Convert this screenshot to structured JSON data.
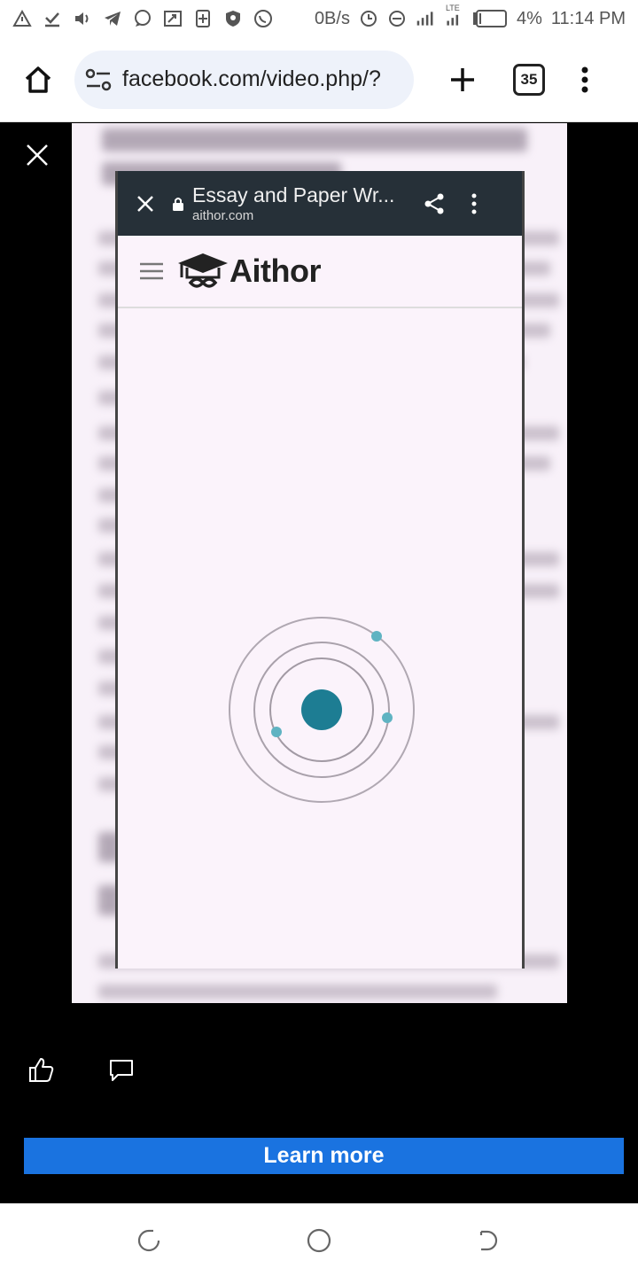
{
  "status_bar": {
    "net_speed": "0B/s",
    "network_type": "LTE",
    "battery": "4%",
    "time": "11:14 PM",
    "icons": [
      "alert-icon",
      "download-done-icon",
      "volume-icon",
      "telegram-icon",
      "chat-icon",
      "cast-icon",
      "sim-icon",
      "shield-icon",
      "whatsapp-icon",
      "data-saver-icon",
      "dnd-icon",
      "signal-icon",
      "signal-icon-2",
      "battery-icon"
    ]
  },
  "browser": {
    "url": "facebook.com/video.php/?",
    "tab_count": "35",
    "icons": {
      "home": "home-icon",
      "site_info": "tune-icon",
      "new_tab": "plus-icon",
      "menu": "more-vert-icon"
    }
  },
  "video": {
    "custom_tab": {
      "title": "Essay and Paper Wr...",
      "domain": "aithor.com"
    },
    "site": {
      "brand": "Aithor"
    },
    "colors": {
      "loader_core": "#1d7d93",
      "loader_dot": "#5fb3c2",
      "tab_bar": "#263038"
    }
  },
  "actions": {
    "learn_more": "Learn more"
  },
  "colors": {
    "accent": "#1a73e0"
  }
}
